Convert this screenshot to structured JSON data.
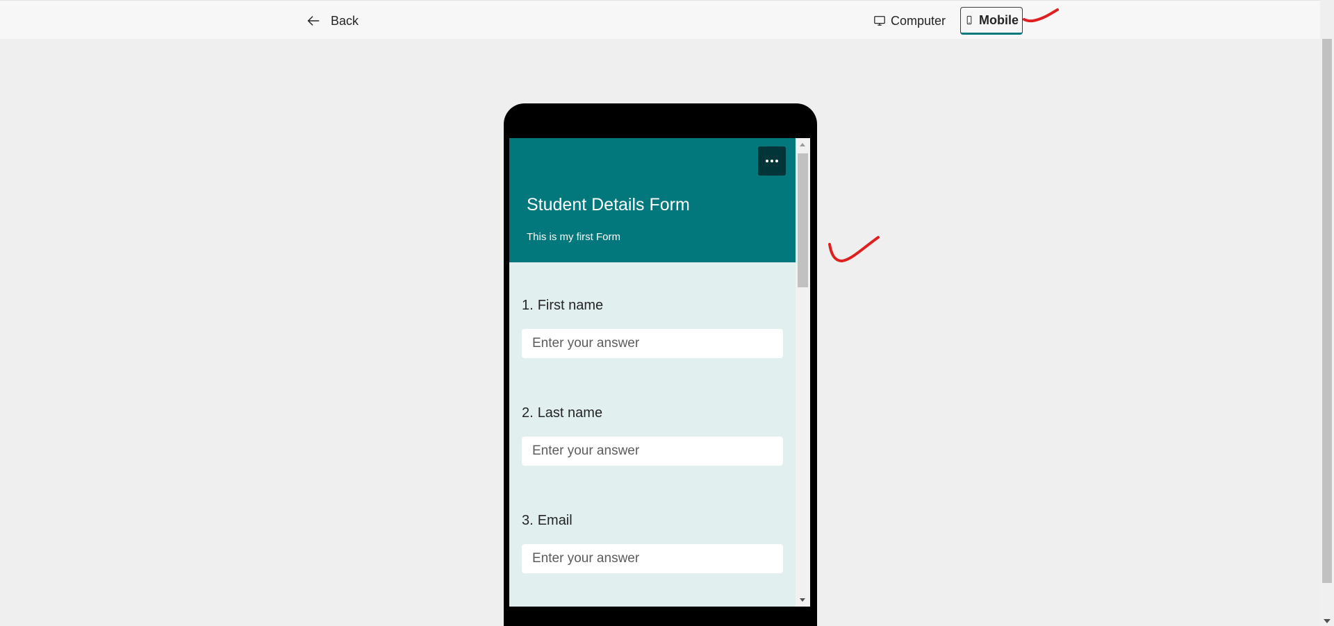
{
  "topbar": {
    "back_label": "Back",
    "computer_label": "Computer",
    "mobile_label": "Mobile",
    "selected_view": "Mobile"
  },
  "form": {
    "title": "Student Details Form",
    "description": "This is my first Form",
    "header_color": "#03787c",
    "questions": [
      {
        "number": "1.",
        "label": "First name",
        "placeholder": "Enter your answer"
      },
      {
        "number": "2.",
        "label": "Last name",
        "placeholder": "Enter your answer"
      },
      {
        "number": "3.",
        "label": "Email",
        "placeholder": "Enter your answer"
      }
    ]
  },
  "icons": {
    "back": "arrow-left-icon",
    "computer": "monitor-icon",
    "mobile": "phone-icon",
    "more": "more-options-icon"
  },
  "annotation_color": "#e02020"
}
